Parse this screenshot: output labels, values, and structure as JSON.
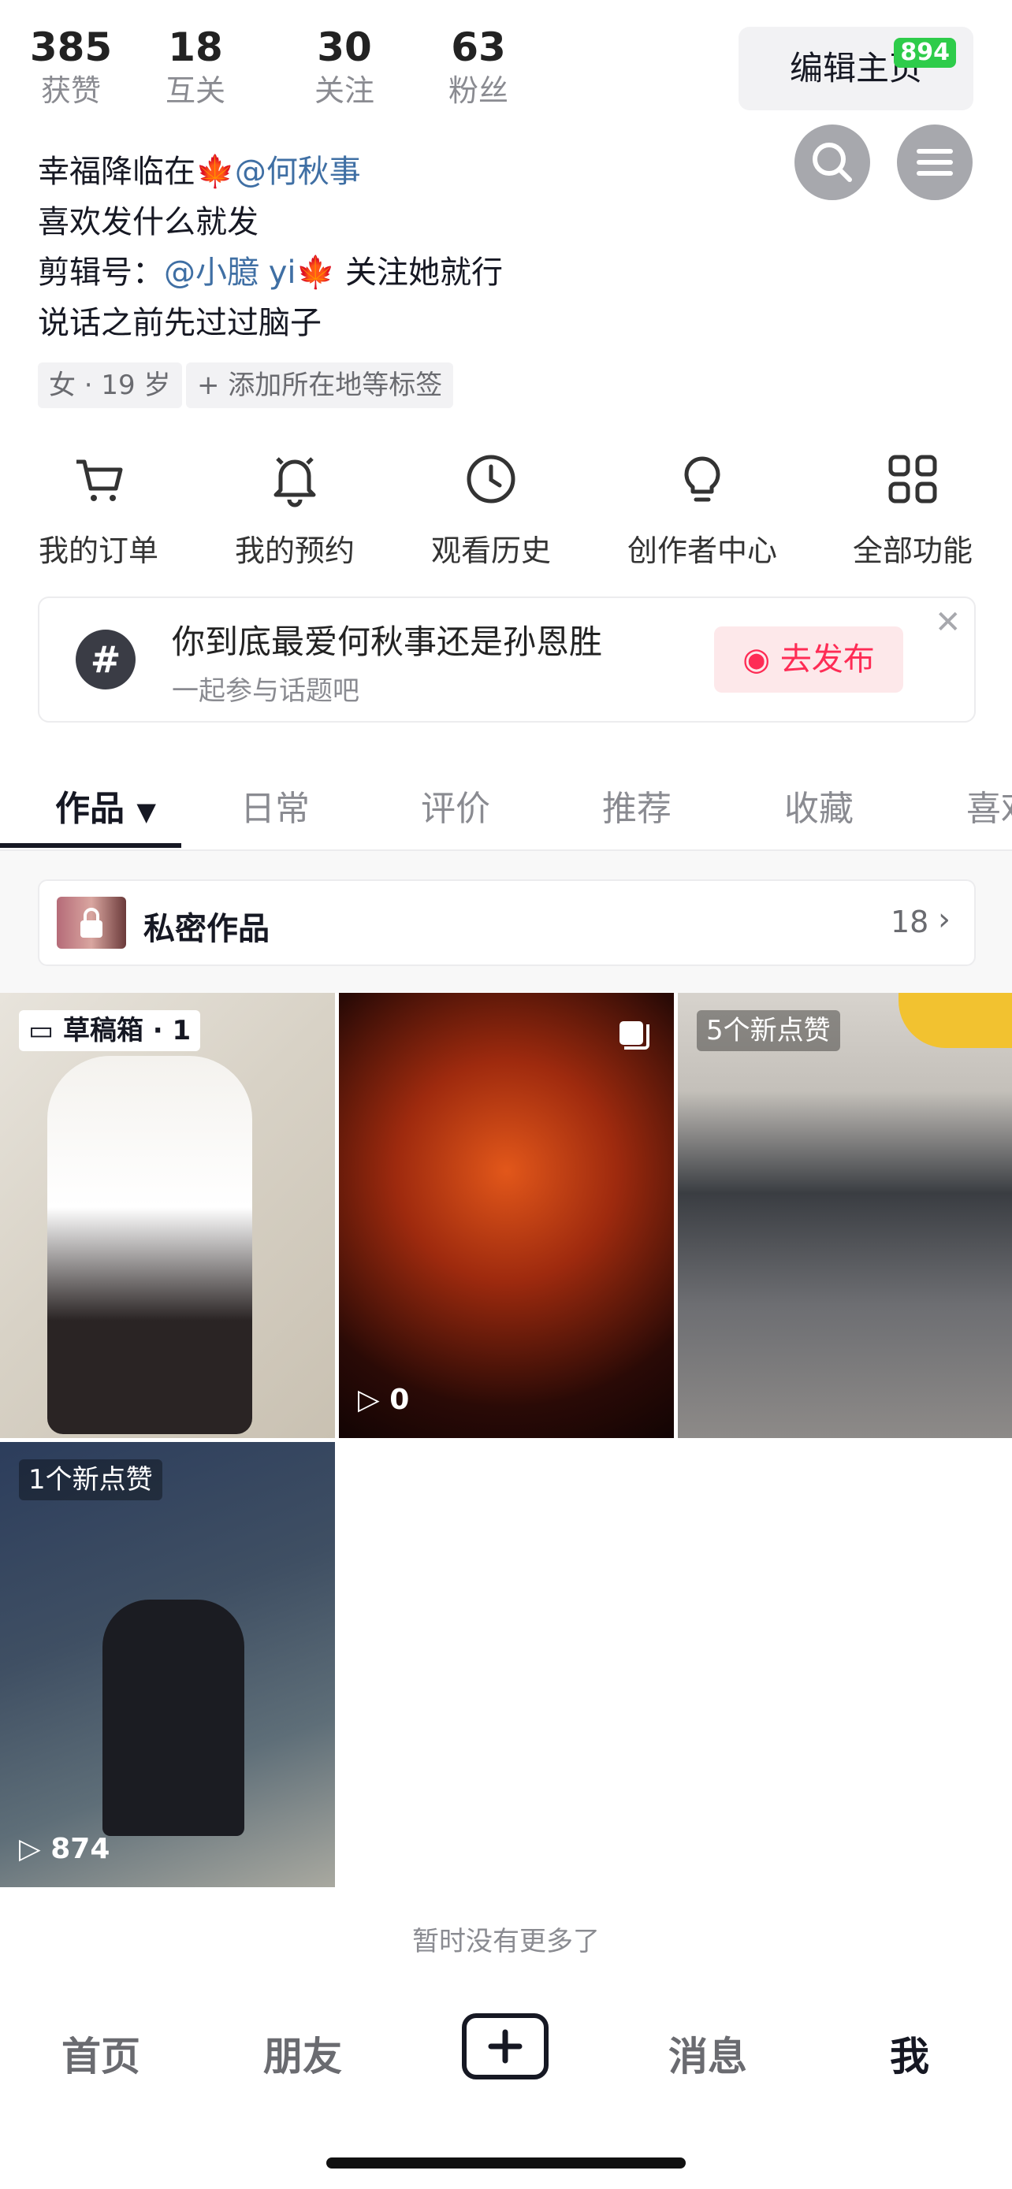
{
  "stats": [
    {
      "num": "385",
      "label": "获赞"
    },
    {
      "num": "18",
      "label": "互关"
    },
    {
      "num": "30",
      "label": "关注"
    },
    {
      "num": "63",
      "label": "粉丝"
    }
  ],
  "edit_button": {
    "label": "编辑主页",
    "badge": "894"
  },
  "bio": {
    "line1_prefix": "幸福降临在",
    "line1_mention": "@何秋事",
    "line2": "喜欢发什么就发",
    "line3_prefix": "剪辑号：",
    "line3_mention": "@小臆 yi",
    "line3_suffix": "关注她就行",
    "line4": "说话之前先过过脑子"
  },
  "tags": {
    "gender_age": "女 · 19 岁",
    "add_tag": "添加所在地等标签"
  },
  "functions": [
    {
      "label": "我的订单",
      "icon": "cart-icon"
    },
    {
      "label": "我的预约",
      "icon": "bell-icon"
    },
    {
      "label": "观看历史",
      "icon": "clock-icon"
    },
    {
      "label": "创作者中心",
      "icon": "bulb-icon"
    },
    {
      "label": "全部功能",
      "icon": "grid-icon"
    }
  ],
  "topic": {
    "title": "你到底最爱何秋事还是孙恩胜",
    "subtitle": "一起参与话题吧",
    "button": "去发布"
  },
  "tabs": [
    "作品",
    "日常",
    "评价",
    "推荐",
    "收藏",
    "喜欢"
  ],
  "private_works": {
    "label": "私密作品",
    "count": "18"
  },
  "grid": [
    {
      "label": "草稿箱 · 1"
    },
    {
      "plays": "0"
    },
    {
      "label": "5个新点赞"
    },
    {
      "label": "1个新点赞",
      "plays": "874"
    }
  ],
  "no_more": "暂时没有更多了",
  "bottom_nav": [
    "首页",
    "朋友",
    "消息",
    "我"
  ],
  "colors": {
    "accent": "#fe2c55",
    "mention": "#3f6fa4",
    "badge": "#2ecc4a"
  }
}
